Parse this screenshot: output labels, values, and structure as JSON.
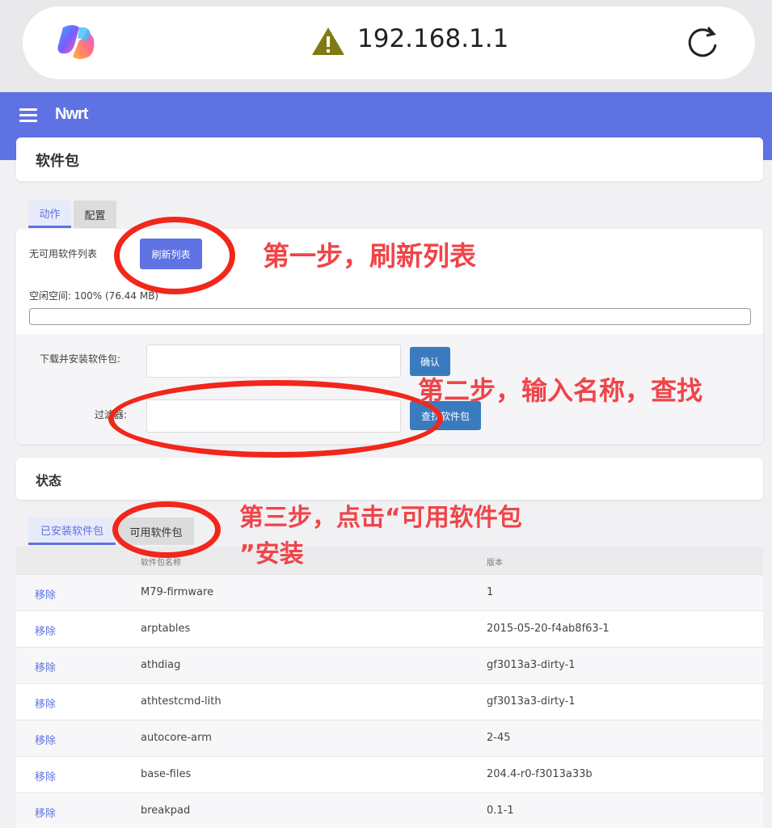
{
  "browser": {
    "url": "192.168.1.1"
  },
  "header": {
    "brand": "Nwrt"
  },
  "page": {
    "title": "软件包"
  },
  "actions": {
    "tabs": [
      {
        "label": "动作",
        "active": true
      },
      {
        "label": "配置",
        "active": false
      }
    ],
    "no_list_text": "无可用软件列表",
    "refresh_label": "刷新列表",
    "free_space_label": "空闲空间:",
    "free_space_value": "100% (76.44 MB)",
    "free_space_percent": 100,
    "download_label": "下载并安装软件包:",
    "download_value": "",
    "confirm_label": "确认",
    "filter_label": "过滤器:",
    "filter_value": "",
    "find_label": "查找软件包"
  },
  "status": {
    "title": "状态",
    "tabs": [
      {
        "label": "已安装软件包",
        "active": true
      },
      {
        "label": "可用软件包",
        "active": false
      }
    ],
    "columns": [
      "软件包名称",
      "版本"
    ],
    "rows": [
      {
        "action": "移除",
        "name": "M79-firmware",
        "version": "1"
      },
      {
        "action": "移除",
        "name": "arptables",
        "version": "2015-05-20-f4ab8f63-1"
      },
      {
        "action": "移除",
        "name": "athdiag",
        "version": "gf3013a3-dirty-1"
      },
      {
        "action": "移除",
        "name": "athtestcmd-lith",
        "version": "gf3013a3-dirty-1"
      },
      {
        "action": "移除",
        "name": "autocore-arm",
        "version": "2-45"
      },
      {
        "action": "移除",
        "name": "base-files",
        "version": "204.4-r0-f3013a33b"
      },
      {
        "action": "移除",
        "name": "breakpad",
        "version": "0.1-1"
      }
    ]
  },
  "annotations": {
    "step1": "第一步，刷新列表",
    "step2": "第二步，输入名称，查找",
    "step3_line1": "第三步，点击“可用软件包",
    "step3_line2": "”安装"
  },
  "colors": {
    "accent": "#5e72e4",
    "button_blue": "#3a7bbf",
    "annotation_red": "#f04449"
  },
  "icons": [
    "copilot-logo-icon",
    "warning-icon",
    "reload-icon",
    "menu-icon"
  ]
}
